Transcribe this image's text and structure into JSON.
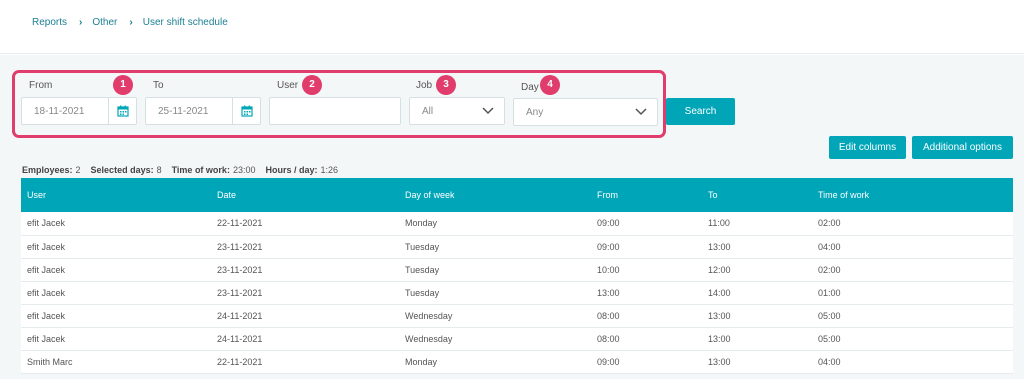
{
  "breadcrumb": [
    "Reports",
    "Other",
    "User shift schedule"
  ],
  "filters": {
    "from": {
      "label": "From",
      "value": "18-11-2021",
      "badge": "1"
    },
    "to": {
      "label": "To",
      "value": "25-11-2021"
    },
    "user": {
      "label": "User",
      "value": "",
      "badge": "2"
    },
    "job": {
      "label": "Job",
      "value": "All",
      "badge": "3"
    },
    "day": {
      "label": "Day",
      "value": "Any",
      "badge": "4"
    },
    "search_label": "Search"
  },
  "actions": {
    "edit_columns": "Edit columns",
    "additional_options": "Additional options"
  },
  "summary": {
    "employees_label": "Employees:",
    "employees": "2",
    "days_label": "Selected days:",
    "days": "8",
    "time_label": "Time of work:",
    "time": "23:00",
    "hpd_label": "Hours / day:",
    "hpd": "1:26"
  },
  "table": {
    "columns": [
      "User",
      "Date",
      "Day of week",
      "From",
      "To",
      "Time of work"
    ],
    "rows": [
      [
        "efit Jacek",
        "22-11-2021",
        "Monday",
        "09:00",
        "11:00",
        "02:00"
      ],
      [
        "efit Jacek",
        "23-11-2021",
        "Tuesday",
        "09:00",
        "13:00",
        "04:00"
      ],
      [
        "efit Jacek",
        "23-11-2021",
        "Tuesday",
        "10:00",
        "12:00",
        "02:00"
      ],
      [
        "efit Jacek",
        "23-11-2021",
        "Tuesday",
        "13:00",
        "14:00",
        "01:00"
      ],
      [
        "efit Jacek",
        "24-11-2021",
        "Wednesday",
        "08:00",
        "13:00",
        "05:00"
      ],
      [
        "efit Jacek",
        "24-11-2021",
        "Wednesday",
        "08:00",
        "13:00",
        "05:00"
      ],
      [
        "Smith Marc",
        "22-11-2021",
        "Monday",
        "09:00",
        "13:00",
        "04:00"
      ]
    ]
  },
  "colors": {
    "accent": "#00a5b8",
    "highlight": "#e03c6c",
    "link": "#1d7f93"
  }
}
